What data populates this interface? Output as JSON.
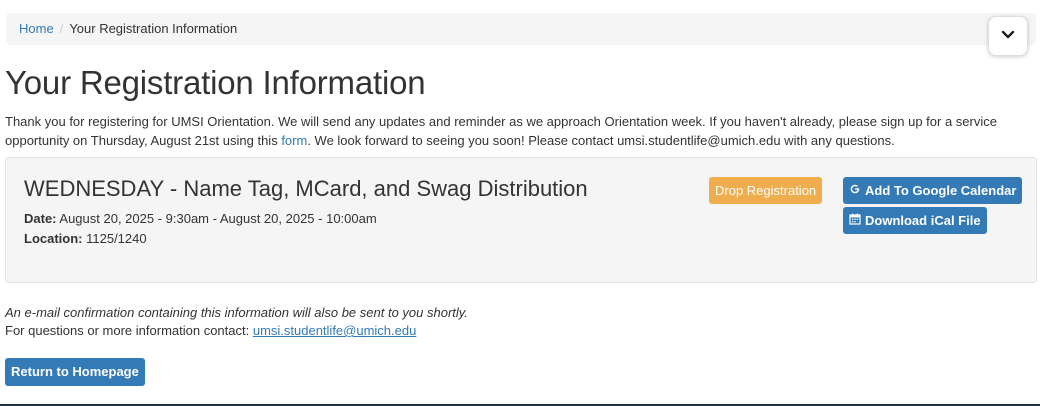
{
  "breadcrumb": {
    "home": "Home",
    "separator": "/",
    "current": "Your Registration Information"
  },
  "toggle": {
    "icon": "chevron-down-icon"
  },
  "page_title": "Your Registration Information",
  "intro": {
    "text_before_link": "Thank you for registering for UMSI Orientation. We will send any updates and reminder as we approach Orientation week. If you haven't already, please sign up for a service opportunity on Thursday, August 21st using this ",
    "link_text": "form",
    "text_after_link": ". We look forward to seeing you soon! Please contact umsi.studentlife@umich.edu with any questions."
  },
  "event": {
    "title": "WEDNESDAY - Name Tag, MCard, and Swag Distribution",
    "date_label": "Date:",
    "date_value": " August 20, 2025 - 9:30am - August 20, 2025 - 10:00am",
    "location_label": "Location:",
    "location_value": " 1125/1240",
    "drop_label": "Drop Registration",
    "google_label": "Add To Google Calendar",
    "ical_label": "Download iCal File"
  },
  "footer": {
    "confirmation": "An e-mail confirmation containing this information will also be sent to you shortly.",
    "contact_prefix": "For questions or more information contact: ",
    "contact_email": "umsi.studentlife@umich.edu",
    "return_label": "Return to Homepage"
  },
  "colors": {
    "link": "#337ab7",
    "warning": "#f0ad4e",
    "primary": "#337ab7",
    "well_bg": "#f5f5f5"
  }
}
